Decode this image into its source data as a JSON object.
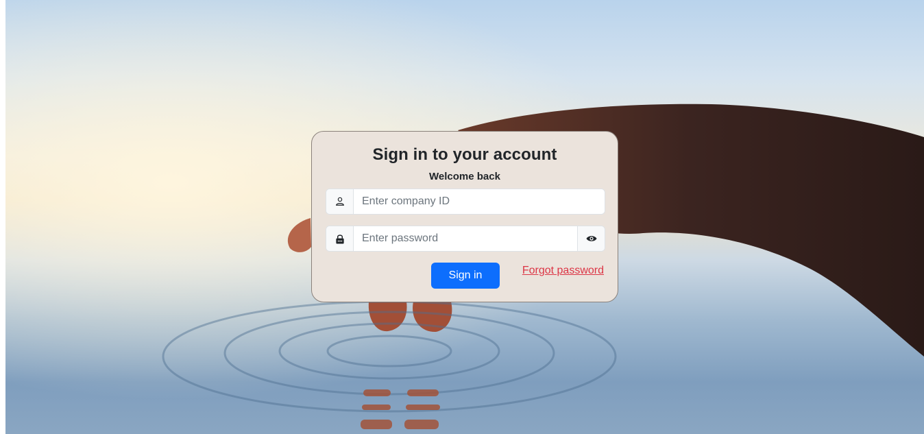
{
  "login": {
    "title": "Sign in to your account",
    "subtitle": "Welcome back",
    "company_id": {
      "placeholder": "Enter company ID",
      "value": "",
      "icon": "user-icon"
    },
    "password": {
      "placeholder": "Enter password",
      "value": "",
      "icon": "lock-icon",
      "toggle_icon": "eye-icon"
    },
    "signin_label": "Sign in",
    "forgot_label": "Forgot password"
  },
  "colors": {
    "primary": "#0d6efd",
    "danger": "#dc3545",
    "card_bg": "#ebe3dc"
  }
}
